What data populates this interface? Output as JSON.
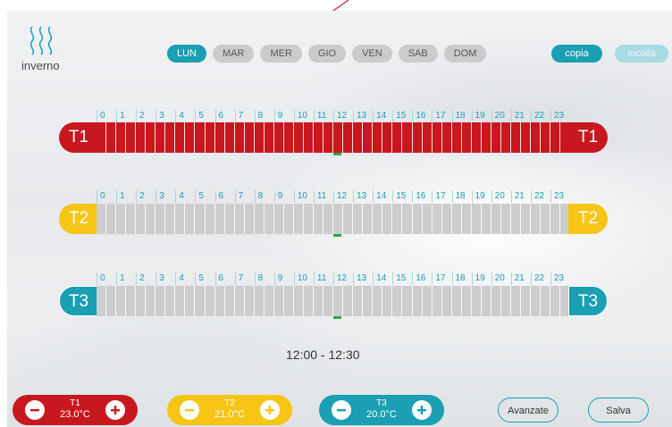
{
  "mode": {
    "icon": "heat-waves-icon",
    "label": "inverno"
  },
  "days": [
    {
      "label": "LUN",
      "active": true
    },
    {
      "label": "MAR",
      "active": false
    },
    {
      "label": "MER",
      "active": false
    },
    {
      "label": "GIO",
      "active": false
    },
    {
      "label": "VEN",
      "active": false
    },
    {
      "label": "SAB",
      "active": false
    },
    {
      "label": "DOM",
      "active": false
    }
  ],
  "actions": {
    "copy": "copia",
    "paste": "incolla"
  },
  "hours": [
    "0",
    "1",
    "2",
    "3",
    "4",
    "5",
    "6",
    "7",
    "8",
    "9",
    "10",
    "11",
    "12",
    "13",
    "14",
    "15",
    "16",
    "17",
    "18",
    "19",
    "20",
    "21",
    "22",
    "23"
  ],
  "schedule": {
    "slots_per_bar": 48,
    "selected_slot": 24,
    "bars": [
      {
        "label": "T1",
        "active": true
      },
      {
        "label": "T2",
        "active": false
      },
      {
        "label": "T3",
        "active": false
      }
    ]
  },
  "selected_range": "12:00 - 12:30",
  "temperatures": [
    {
      "name": "T1",
      "value": "23.0°C"
    },
    {
      "name": "T2",
      "value": "21.0°C"
    },
    {
      "name": "T3",
      "value": "20.0°C"
    }
  ],
  "buttons": {
    "advanced": "Avanzate",
    "save": "Salva"
  },
  "colors": {
    "t1": "#c8171e",
    "t2": "#f6c516",
    "t3": "#1a9fb3",
    "accent": "#1a9fb3",
    "inactive_slot": "#cdcdcd"
  }
}
